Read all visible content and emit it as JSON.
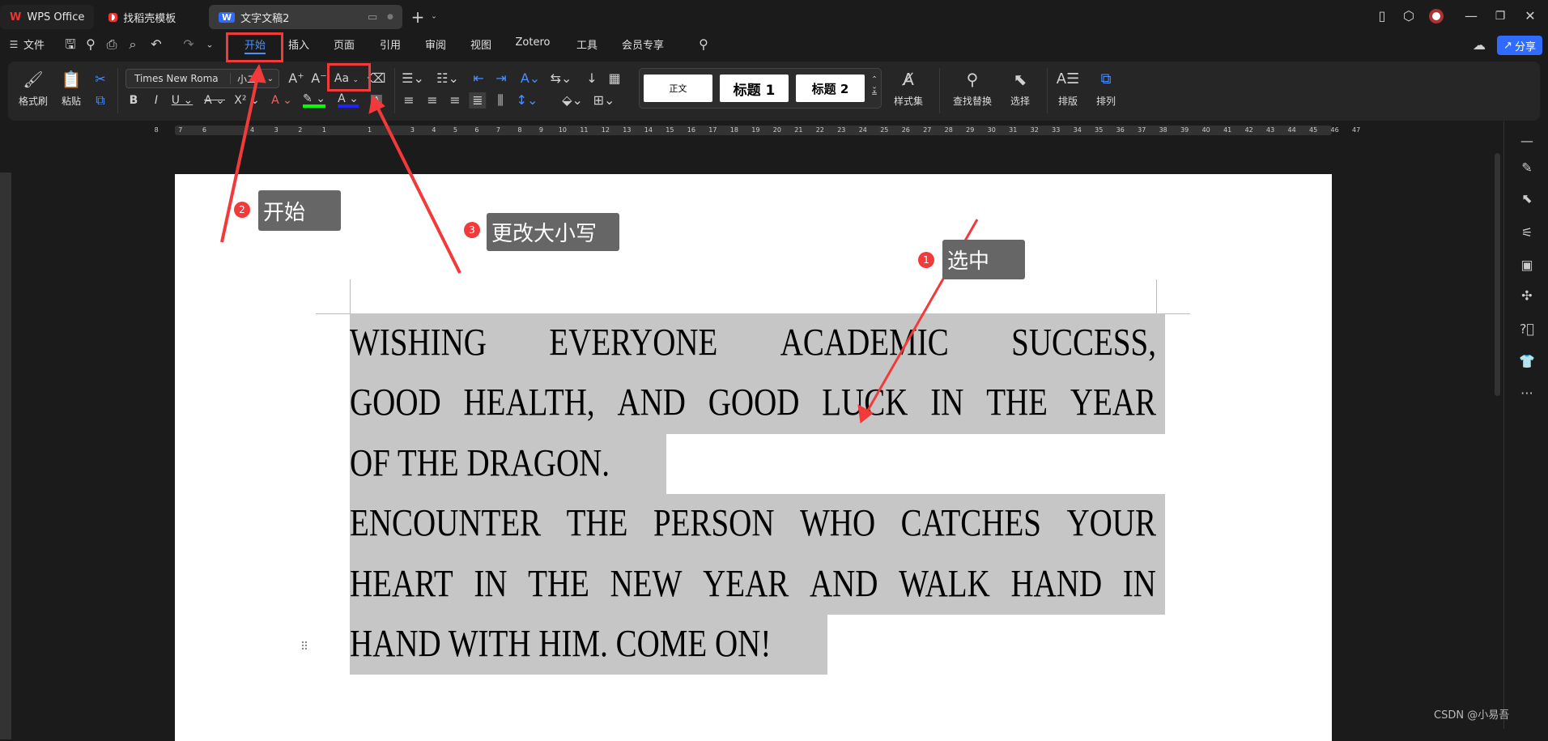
{
  "titlebar": {
    "tabs": [
      {
        "label": "WPS Office",
        "icon": "wps-logo-icon"
      },
      {
        "label": "找稻壳模板",
        "icon": "docer-icon"
      },
      {
        "label": "文字文稿2",
        "icon": "writer-doc-icon"
      }
    ],
    "new_tab": "+",
    "controls": [
      "phone-icon",
      "cube-icon",
      "avatar",
      "minimize-icon",
      "restore-icon",
      "close-icon"
    ]
  },
  "menubar": {
    "file": "文件",
    "items": [
      "开始",
      "插入",
      "页面",
      "引用",
      "审阅",
      "视图",
      "Zotero",
      "工具",
      "会员专享"
    ],
    "active": "开始",
    "share": "分享"
  },
  "ribbon": {
    "format_painter": "格式刷",
    "paste": "粘贴",
    "font_name": "Times New Roma",
    "font_size": "小二",
    "change_case": "Aa",
    "styles": [
      "正文",
      "标题 1",
      "标题 2"
    ],
    "style_set": "样式集",
    "find_replace": "查找替换",
    "select": "选择",
    "layout": "排版",
    "arrange": "排列"
  },
  "ruler": {
    "left": [
      "8",
      "7",
      "6",
      "",
      "4",
      "3",
      "2",
      "1"
    ],
    "right": [
      "1",
      "",
      "3",
      "4",
      "5",
      "6",
      "7",
      "8",
      "9",
      "10",
      "11",
      "12",
      "13",
      "14",
      "15",
      "16",
      "17",
      "18",
      "19",
      "20",
      "21",
      "22",
      "23",
      "24",
      "25",
      "26",
      "27",
      "28",
      "29",
      "30",
      "31",
      "32",
      "33",
      "34",
      "35",
      "36",
      "37",
      "38",
      "39",
      "40",
      "41",
      "42",
      "43",
      "44",
      "45",
      "46",
      "47"
    ]
  },
  "document": {
    "lines": [
      "WISHING EVERYONE ACADEMIC SUCCESS,",
      "GOOD HEALTH, AND GOOD LUCK IN THE YEAR",
      "OF THE DRAGON.",
      "ENCOUNTER THE PERSON WHO CATCHES YOUR",
      "HEART IN THE NEW YEAR AND WALK HAND IN",
      "HAND WITH HIM. COME ON!"
    ],
    "selection_color": "#c6c6c6"
  },
  "annotations": [
    {
      "num": "1",
      "text": "选中"
    },
    {
      "num": "2",
      "text": "开始"
    },
    {
      "num": "3",
      "text": "更改大小写"
    }
  ],
  "annotation_color": "#f23a3a",
  "watermark": "CSDN @小易吾",
  "accent": "#4a90ff"
}
